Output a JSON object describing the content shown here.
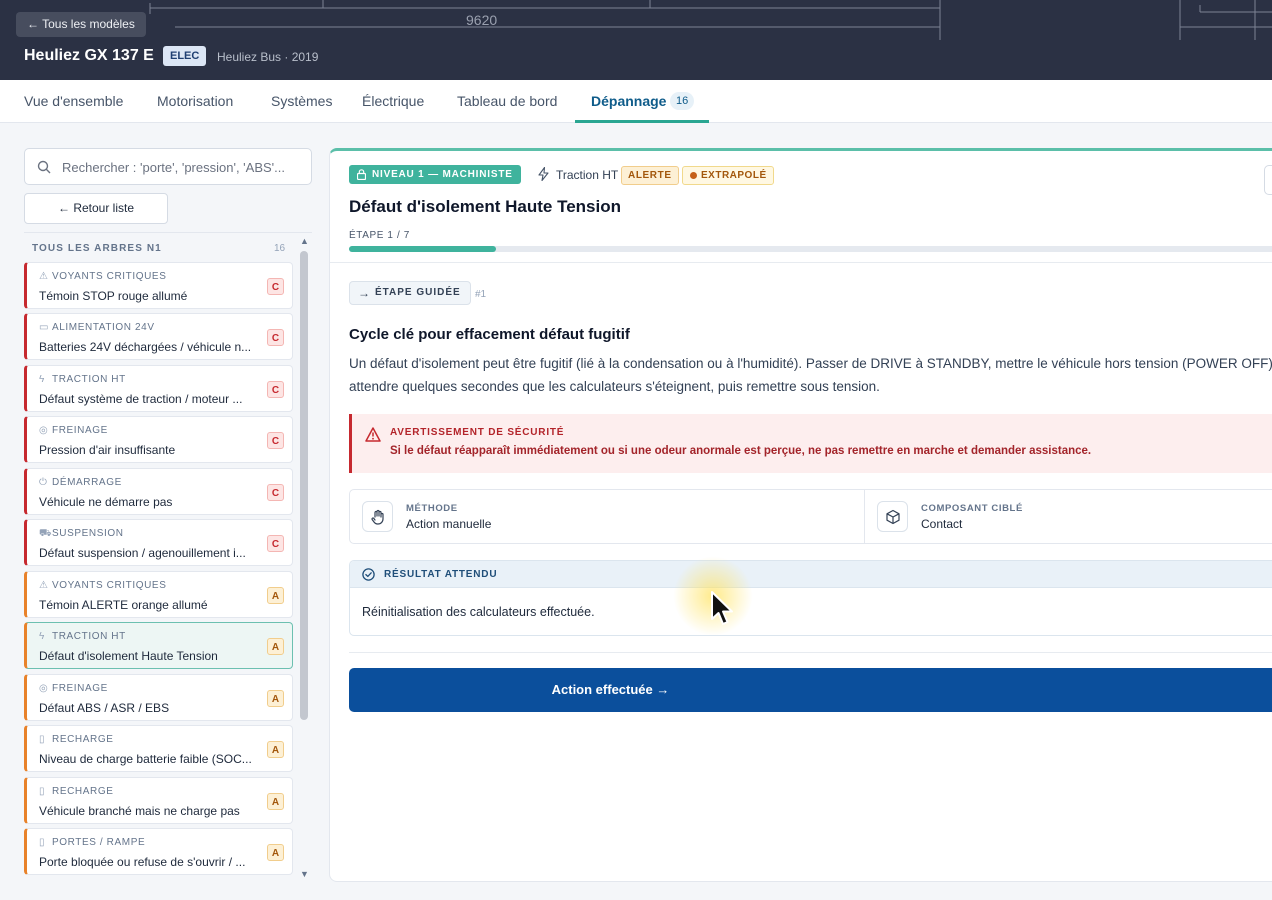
{
  "header": {
    "back_label": "← Tous les modèles",
    "model_name": "Heuliez GX 137 E",
    "badge": "ELEC",
    "subtitle": "Heuliez Bus · 2019",
    "blueprint_dimension": "9620"
  },
  "tabs": [
    {
      "label": "Vue d'ensemble",
      "active": false
    },
    {
      "label": "Motorisation",
      "active": false
    },
    {
      "label": "Systèmes",
      "active": false
    },
    {
      "label": "Électrique",
      "active": false
    },
    {
      "label": "Tableau de bord",
      "active": false
    },
    {
      "label": "Dépannage",
      "active": true,
      "count": "16"
    }
  ],
  "sidebar": {
    "search_placeholder": "Rechercher : 'porte', 'pression', 'ABS'...",
    "back_list_label": "← Retour liste",
    "list_title": "TOUS LES ARBRES N1",
    "list_count": "16",
    "items": [
      {
        "category": "VOYANTS CRITIQUES",
        "icon": "warning-icon",
        "title": "Témoin STOP rouge allumé",
        "level": "C",
        "severity": "critical"
      },
      {
        "category": "ALIMENTATION 24V",
        "icon": "battery-icon",
        "title": "Batteries 24V déchargées / véhicule n...",
        "level": "C",
        "severity": "critical"
      },
      {
        "category": "TRACTION HT",
        "icon": "bolt-icon",
        "title": "Défaut système de traction / moteur ...",
        "level": "C",
        "severity": "critical"
      },
      {
        "category": "FREINAGE",
        "icon": "brake-icon",
        "title": "Pression d'air insuffisante",
        "level": "C",
        "severity": "critical"
      },
      {
        "category": "DÉMARRAGE",
        "icon": "power-icon",
        "title": "Véhicule ne démarre pas",
        "level": "C",
        "severity": "critical"
      },
      {
        "category": "SUSPENSION",
        "icon": "car-icon",
        "title": "Défaut suspension / agenouillement i...",
        "level": "C",
        "severity": "critical"
      },
      {
        "category": "VOYANTS CRITIQUES",
        "icon": "warning-icon",
        "title": "Témoin ALERTE orange allumé",
        "level": "A",
        "severity": "alert"
      },
      {
        "category": "TRACTION HT",
        "icon": "bolt-icon",
        "title": "Défaut d'isolement Haute Tension",
        "level": "A",
        "severity": "alert",
        "active": true
      },
      {
        "category": "FREINAGE",
        "icon": "brake-icon",
        "title": "Défaut ABS / ASR / EBS",
        "level": "A",
        "severity": "alert"
      },
      {
        "category": "RECHARGE",
        "icon": "battery-icon",
        "title": "Niveau de charge batterie faible (SOC...",
        "level": "A",
        "severity": "alert"
      },
      {
        "category": "RECHARGE",
        "icon": "battery-icon",
        "title": "Véhicule branché mais ne charge pas",
        "level": "A",
        "severity": "alert"
      },
      {
        "category": "PORTES / RAMPE",
        "icon": "door-icon",
        "title": "Porte bloquée ou refuse de s'ouvrir / ...",
        "level": "A",
        "severity": "alert"
      }
    ]
  },
  "panel": {
    "level_badge": "NIVEAU 1 — MACHINISTE",
    "system": "Traction HT",
    "alert_badge": "ALERTE",
    "extrapolated_badge": "EXTRAPOLÉ",
    "title": "Défaut d'isolement Haute Tension",
    "step_label": "ÉTAPE 1 / 7",
    "progress": 0.1567,
    "guided_label": "ÉTAPE GUIDÉE",
    "step_number": "#1",
    "step_title": "Cycle clé pour effacement défaut fugitif",
    "step_description": "Un défaut d'isolement peut être fugitif (lié à la condensation ou à l'humidité). Passer de DRIVE à STANDBY, mettre le véhicule hors tension (POWER OFF), attendre quelques secondes que les calculateurs s'éteignent, puis remettre sous tension.",
    "warning_title": "AVERTISSEMENT DE SÉCURITÉ",
    "warning_text": "Si le défaut réapparaît immédiatement ou si une odeur anormale est perçue, ne pas remettre en marche et demander assistance.",
    "method_label": "MÉTHODE",
    "method_value": "Action manuelle",
    "component_label": "COMPOSANT CIBLÉ",
    "component_value": "Contact",
    "result_label": "RÉSULTAT ATTENDU",
    "result_value": "Réinitialisation des calculateurs effectuée.",
    "action_label": "Action effectuée →"
  },
  "colors": {
    "header_bg": "#2b3144",
    "accent_teal": "#3fb39d",
    "critical": "#c6292f",
    "alert": "#e8822a",
    "primary_button": "#0b4f9c"
  }
}
